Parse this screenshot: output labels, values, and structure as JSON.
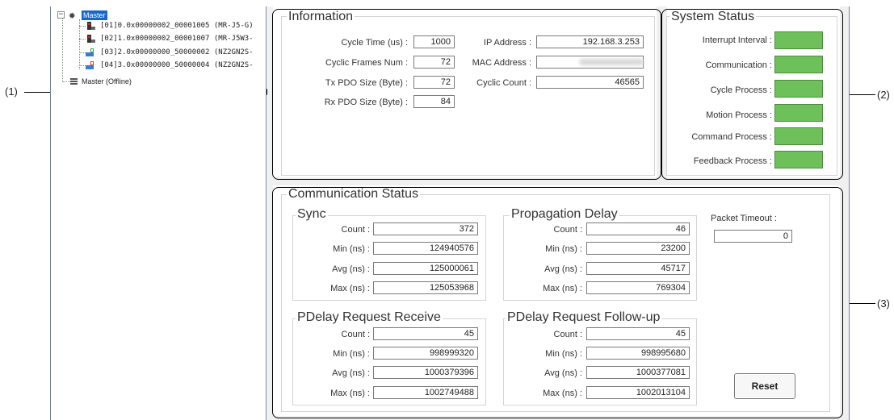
{
  "tree": {
    "root_label": "Master",
    "items": [
      {
        "label": "[01]0.0x00000002_00001005 (MR-J5-G)"
      },
      {
        "label": "[02]1.0x00000002_00001007 (MR-J5W3-"
      },
      {
        "label": "[03]2.0x00000000_50000002 (NZ2GN2S-"
      },
      {
        "label": "[04]3.0x00000000_50000004 (NZ2GN2S-"
      }
    ],
    "offline_label": "Master (Offline)"
  },
  "callouts": {
    "c1": "(1)",
    "c2": "(2)",
    "c3": "(3)"
  },
  "information": {
    "title": "Information",
    "cycle_time_label": "Cycle Time (us) :",
    "cycle_time": "1000",
    "cyclic_frames_label": "Cyclic Frames Num :",
    "cyclic_frames": "72",
    "tx_pdo_label": "Tx PDO Size (Byte) :",
    "tx_pdo": "72",
    "rx_pdo_label": "Rx PDO Size (Byte) :",
    "rx_pdo": "84",
    "ip_label": "IP Address :",
    "ip": "192.168.3.253",
    "mac_label": "MAC Address :",
    "mac": "",
    "cyclic_count_label": "Cyclic Count :",
    "cyclic_count": "46565"
  },
  "system_status": {
    "title": "System Status",
    "led_color": "#6ec15a",
    "items": [
      {
        "label": "Interrupt Interval :"
      },
      {
        "label": "Communication :"
      },
      {
        "label": "Cycle Process :"
      },
      {
        "label": "Motion Process :"
      },
      {
        "label": "Command Process :"
      },
      {
        "label": "Feedback Process :"
      }
    ]
  },
  "communication": {
    "title": "Communication Status",
    "sync": {
      "title": "Sync",
      "count": "372",
      "min": "124940576",
      "avg": "125000061",
      "max": "125053968"
    },
    "propagation": {
      "title": "Propagation Delay",
      "count": "46",
      "min": "23200",
      "avg": "45717",
      "max": "769304"
    },
    "pdelay_receive": {
      "title": "PDelay Request Receive",
      "count": "45",
      "min": "998999320",
      "avg": "1000379396",
      "max": "1002749488"
    },
    "pdelay_followup": {
      "title": "PDelay Request Follow-up",
      "count": "45",
      "min": "998995680",
      "avg": "1000377081",
      "max": "1002013104"
    },
    "labels": {
      "count": "Count :",
      "min": "Min (ns) :",
      "avg": "Avg (ns) :",
      "max": "Max (ns) :"
    },
    "packet_timeout_label": "Packet Timeout :",
    "packet_timeout": "0",
    "reset_label": "Reset"
  }
}
